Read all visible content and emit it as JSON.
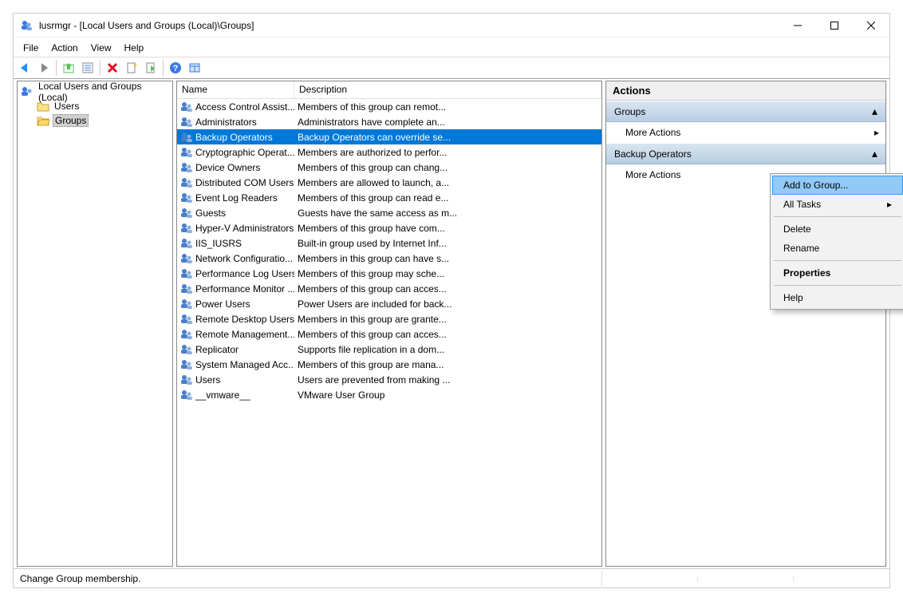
{
  "title": "lusrmgr - [Local Users and Groups (Local)\\Groups]",
  "menu": {
    "file": "File",
    "action": "Action",
    "view": "View",
    "help": "Help"
  },
  "tree": {
    "root": "Local Users and Groups (Local)",
    "users": "Users",
    "groups": "Groups"
  },
  "columns": {
    "name": "Name",
    "description": "Description"
  },
  "groups": [
    {
      "name": "Access Control Assist...",
      "desc": "Members of this group can remot..."
    },
    {
      "name": "Administrators",
      "desc": "Administrators have complete an..."
    },
    {
      "name": "Backup Operators",
      "desc": "Backup Operators can override se...",
      "selected": true
    },
    {
      "name": "Cryptographic Operat...",
      "desc": "Members are authorized to perfor..."
    },
    {
      "name": "Device Owners",
      "desc": "Members of this group can chang..."
    },
    {
      "name": "Distributed COM Users",
      "desc": "Members are allowed to launch, a..."
    },
    {
      "name": "Event Log Readers",
      "desc": "Members of this group can read e..."
    },
    {
      "name": "Guests",
      "desc": "Guests have the same access as m..."
    },
    {
      "name": "Hyper-V Administrators",
      "desc": "Members of this group have com..."
    },
    {
      "name": "IIS_IUSRS",
      "desc": "Built-in group used by Internet Inf..."
    },
    {
      "name": "Network Configuratio...",
      "desc": "Members in this group can have s..."
    },
    {
      "name": "Performance Log Users",
      "desc": "Members of this group may sche..."
    },
    {
      "name": "Performance Monitor ...",
      "desc": "Members of this group can acces..."
    },
    {
      "name": "Power Users",
      "desc": "Power Users are included for back..."
    },
    {
      "name": "Remote Desktop Users",
      "desc": "Members in this group are grante..."
    },
    {
      "name": "Remote Management...",
      "desc": "Members of this group can acces..."
    },
    {
      "name": "Replicator",
      "desc": "Supports file replication in a dom..."
    },
    {
      "name": "System Managed Acc...",
      "desc": "Members of this group are mana..."
    },
    {
      "name": "Users",
      "desc": "Users are prevented from making ..."
    },
    {
      "name": "__vmware__",
      "desc": "VMware User Group"
    }
  ],
  "actions": {
    "title": "Actions",
    "section1": "Groups",
    "more1": "More Actions",
    "section2": "Backup Operators",
    "more2": "More Actions"
  },
  "context": {
    "add": "Add to Group...",
    "alltasks": "All Tasks",
    "delete": "Delete",
    "rename": "Rename",
    "properties": "Properties",
    "help": "Help"
  },
  "status": "Change Group membership."
}
